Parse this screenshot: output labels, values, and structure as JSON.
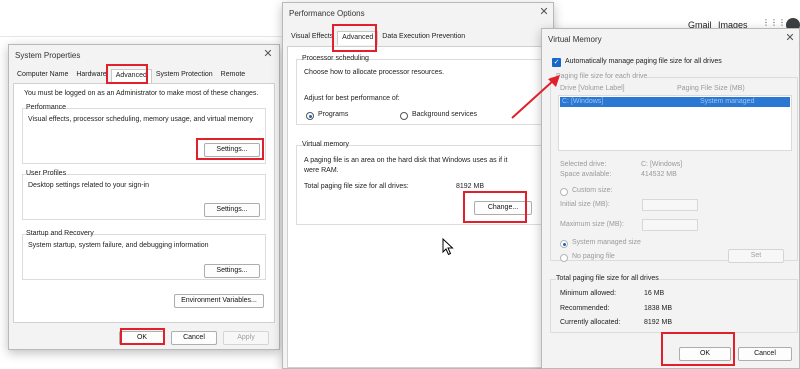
{
  "backdrop": {
    "gmail": "Gmail",
    "images": "Images",
    "apps": "⋮⋮⋮"
  },
  "system_properties": {
    "title": "System Properties",
    "tabs": [
      "Computer Name",
      "Hardware",
      "Advanced",
      "System Protection",
      "Remote"
    ],
    "admin_note": "You must be logged on as an Administrator to make most of these changes.",
    "performance": {
      "title": "Performance",
      "desc": "Visual effects, processor scheduling, memory usage, and virtual memory",
      "button": "Settings..."
    },
    "user_profiles": {
      "title": "User Profiles",
      "desc": "Desktop settings related to your sign-in",
      "button": "Settings..."
    },
    "startup": {
      "title": "Startup and Recovery",
      "desc": "System startup, system failure, and debugging information",
      "button": "Settings..."
    },
    "env_button": "Environment Variables...",
    "ok": "OK",
    "cancel": "Cancel",
    "apply": "Apply"
  },
  "performance_options": {
    "title": "Performance Options",
    "tabs": [
      "Visual Effects",
      "Advanced",
      "Data Execution Prevention"
    ],
    "processor": {
      "title": "Processor scheduling",
      "desc": "Choose how to allocate processor resources.",
      "adjust": "Adjust for best performance of:",
      "programs": "Programs",
      "background": "Background services"
    },
    "virtual_memory": {
      "title": "Virtual memory",
      "desc_line1": "A paging file is an area on the hard disk that Windows uses as if it",
      "desc_line2": "were RAM.",
      "total_label": "Total paging file size for all drives:",
      "total_value": "8192 MB",
      "change": "Change..."
    }
  },
  "virtual_memory_dialog": {
    "title": "Virtual Memory",
    "auto_manage": "Automatically manage paging file size for all drives",
    "paging_header": "Paging file size for each drive",
    "col_drive": "Drive  [Volume Label]",
    "col_size": "Paging File Size (MB)",
    "row_drive": "C:      [Windows]",
    "row_size": "System managed",
    "selected_drive_label": "Selected drive:",
    "selected_drive_value": "C:  [Windows]",
    "space_label": "Space available:",
    "space_value": "414532 MB",
    "custom_size": "Custom size:",
    "initial_size": "Initial size (MB):",
    "maximum_size": "Maximum size (MB):",
    "system_managed": "System managed size",
    "no_paging": "No paging file",
    "set": "Set",
    "totals_title": "Total paging file size for all drives",
    "min_label": "Minimum allowed:",
    "min_value": "16 MB",
    "rec_label": "Recommended:",
    "rec_value": "1838 MB",
    "cur_label": "Currently allocated:",
    "cur_value": "8192 MB",
    "ok": "OK",
    "cancel": "Cancel"
  },
  "colors": {
    "highlight": "#e0202a",
    "accent": "#1a66c7",
    "selection": "#2b78d4"
  }
}
